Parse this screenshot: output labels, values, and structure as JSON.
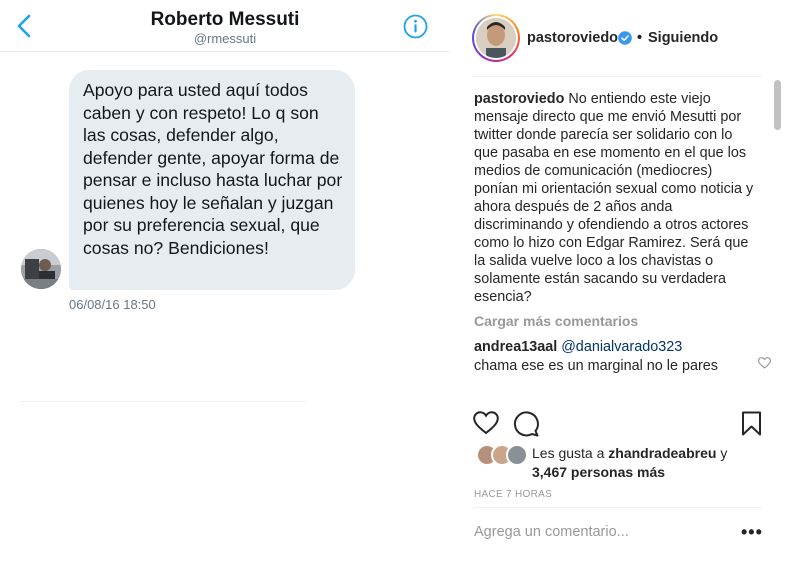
{
  "twitter": {
    "name": "Roberto Messuti",
    "handle": "@rmessuti",
    "message": "Apoyo para usted aquí todos caben y con respeto! Lo q son las cosas, defender algo, defender gente, apoyar forma de pensar e incluso hasta luchar por quienes hoy le señalan y juzgan por su preferencia sexual, que cosas no? Bendiciones!",
    "timestamp": "06/08/16 18:50",
    "accent_color": "#1da1f2",
    "icons": [
      "back-chevron-icon",
      "info-icon"
    ]
  },
  "instagram": {
    "username": "pastoroviedo",
    "separator": "•",
    "follow_status": "Siguiendo",
    "caption_user": "pastoroviedo",
    "caption_text": "No entiendo este viejo mensaje directo que me envió Mesutti por twitter donde parecía ser solidario con lo que pasaba en ese momento en el que los medios de comunicación (mediocres) ponían mi orientación sexual como noticia y ahora después de 2 años anda discriminando y ofendiendo a otros actores como lo hizo con Edgar Ramirez. Será que la salida vuelve loco a los chavistas o solamente están sacando su verdadera esencia?",
    "load_more": "Cargar más comentarios",
    "comment_user": "andrea13aal",
    "comment_mention": "@danialvarado323",
    "comment_text": "chama ese es un marginal no le pares",
    "likes_prefix": "Les gusta a",
    "likes_user": "zhandradeabreu",
    "likes_connector": "y",
    "likes_count": "3,467 personas más",
    "time_ago": "HACE 7 HORAS",
    "comment_placeholder": "Agrega un comentario...",
    "more_options": "•••",
    "verified_color": "#3897f0"
  }
}
